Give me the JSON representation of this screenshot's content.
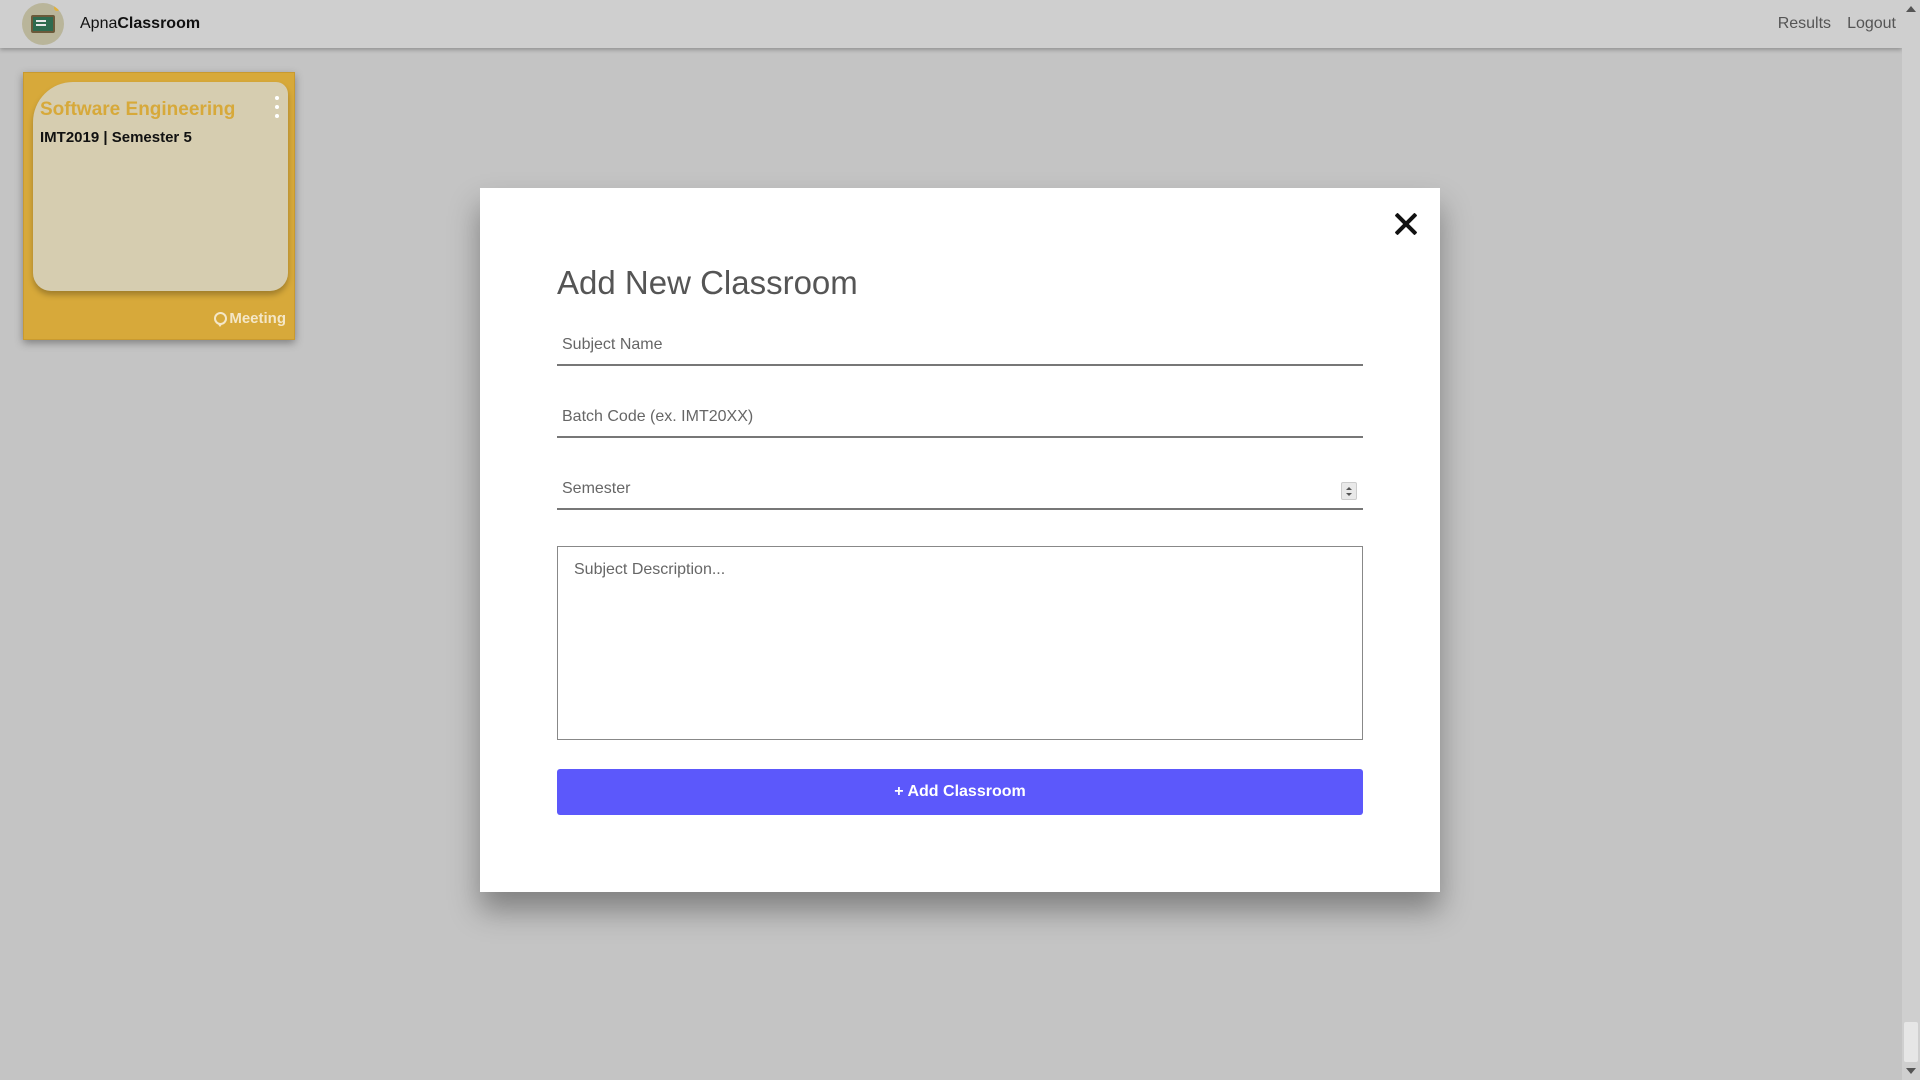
{
  "navbar": {
    "brand_prefix": "Apna",
    "brand_suffix": "Classroom",
    "links": [
      "Results",
      "Logout"
    ]
  },
  "class_card": {
    "title": "Software Engineering",
    "subtitle": "IMT2019 | Semester 5",
    "meeting_label": "Meeting",
    "color": "#d7a93a"
  },
  "modal": {
    "title": "Add New Classroom",
    "subject_placeholder": "Subject Name",
    "batch_placeholder": "Batch Code (ex. IMT20XX)",
    "semester_placeholder": "Semester",
    "description_placeholder": "Subject Description...",
    "submit_label": "+ Add Classroom",
    "accent": "#5c58fb"
  },
  "icons": {
    "logo": "classroom-board-logo",
    "close": "close-icon",
    "kebab": "more-vert-icon",
    "meeting": "chat-bubble-icon"
  }
}
